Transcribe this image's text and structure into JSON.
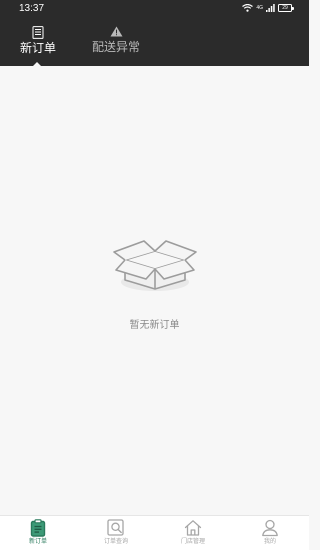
{
  "status_bar": {
    "time": "13:37",
    "network": "4G",
    "battery": "29",
    "icons": [
      "wifi-icon",
      "signal-icon",
      "battery-icon"
    ]
  },
  "top_tabs": {
    "items": [
      {
        "label": "新订单",
        "icon": "document-list-icon",
        "active": true
      },
      {
        "label": "配送异常",
        "icon": "warning-icon",
        "active": false
      }
    ]
  },
  "main": {
    "empty_icon": "open-box-icon",
    "empty_message": "暂无新订单"
  },
  "bottom_nav": {
    "items": [
      {
        "label": "新订单",
        "icon": "clipboard-icon",
        "active": true
      },
      {
        "label": "订单查询",
        "icon": "search-document-icon",
        "active": false
      },
      {
        "label": "门店管理",
        "icon": "store-house-icon",
        "active": false
      },
      {
        "label": "我的",
        "icon": "user-icon",
        "active": false
      }
    ]
  },
  "colors": {
    "top_bar": "#2b2b2b",
    "background": "#f7f7f7",
    "active_green": "#2a7a5c",
    "inactive_gray": "#a6a6a6"
  }
}
